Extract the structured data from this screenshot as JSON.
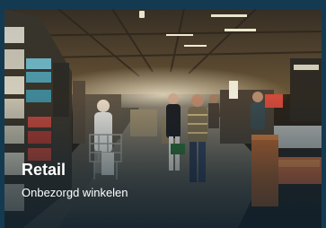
{
  "card": {
    "title": "Retail",
    "subtitle": "Onbezorgd winkelen"
  },
  "image": {
    "subject": "supermarket-aisle-photo"
  },
  "colors": {
    "frame_background": "#143a52",
    "caption_text": "#ffffff"
  }
}
